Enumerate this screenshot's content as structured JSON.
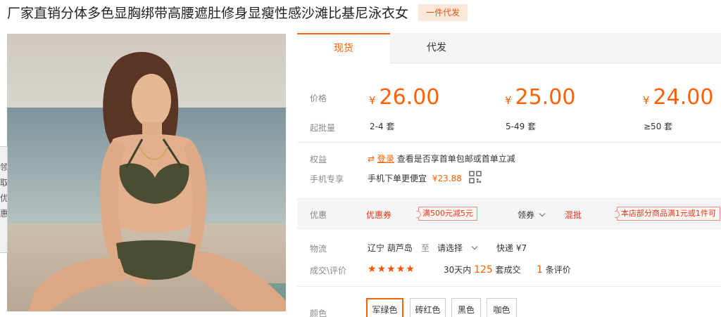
{
  "product": {
    "title": "厂家直销分体多色显胸绑带高腰遮肚修身显瘦性感沙滩比基尼泳衣女",
    "badge": "一件代发",
    "side_tab_text": "领取优惠"
  },
  "tabs": [
    {
      "label": "现货",
      "active": true
    },
    {
      "label": "代发",
      "active": false
    }
  ],
  "pricing": {
    "price_label": "价格",
    "moq_label": "起批量",
    "currency": "¥",
    "tiers": [
      {
        "price": "26.00",
        "quantity": "2-4",
        "unit": "套"
      },
      {
        "price": "25.00",
        "quantity": "5-49",
        "unit": "套"
      },
      {
        "price": "24.00",
        "quantity": "≥50",
        "unit": "套"
      }
    ]
  },
  "benefits": {
    "label": "权益",
    "login_link": "登录",
    "text": "查看是否享首单包邮或首单立减"
  },
  "mobile": {
    "label": "手机专享",
    "text": "手机下单更便宜",
    "price": "¥23.88"
  },
  "promotions": {
    "label": "优惠",
    "coupon_title": "优惠券",
    "coupon": "满500元减5元",
    "claim": "领券",
    "mixed_label": "混批",
    "mixed_text": "本店部分商品满1元或1件可"
  },
  "logistics": {
    "label": "物流",
    "origin": "辽宁  葫芦岛",
    "to": "至",
    "destination": "请选择",
    "shipping": "快递 ¥7"
  },
  "deals": {
    "label": "成交\\评价",
    "rating": 5,
    "period": "30天内",
    "count": "125",
    "count_suffix": "套成交",
    "reviews_count": "1",
    "reviews_suffix": "条评价"
  },
  "colors": {
    "label": "颜色",
    "options": [
      "军绿色",
      "砖红色",
      "黑色",
      "咖色"
    ],
    "selected": "军绿色"
  },
  "theme": {
    "accent": "#ff6000",
    "badge_bg": "#fbe7d8",
    "star": "#ff5000"
  }
}
